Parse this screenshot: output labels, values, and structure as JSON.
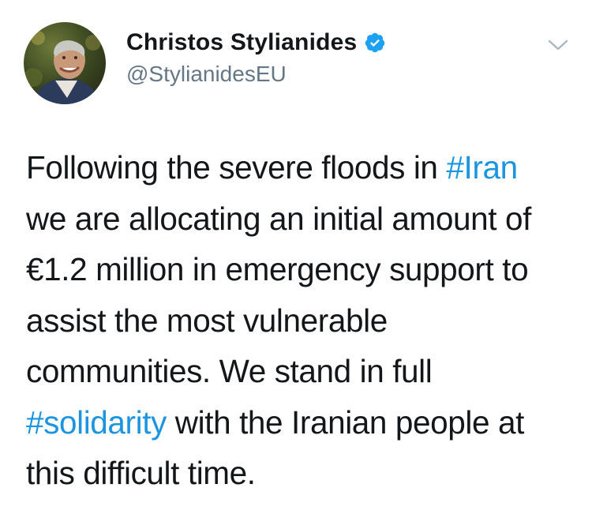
{
  "user": {
    "display_name": "Christos Stylianides",
    "handle": "@StylianidesEU",
    "verified": true,
    "verified_color": "#1da1f2"
  },
  "menu": {
    "icon": "chevron-down-icon"
  },
  "tweet": {
    "lines": [
      {
        "t1": "Following the severe floods in ",
        "hashtag": "#Iran",
        "t2": ""
      },
      {
        "t1": "we are allocating an initial amount of"
      },
      {
        "t1": "€1.2 million in emergency support to"
      },
      {
        "t1": "assist the most vulnerable"
      },
      {
        "t1": "communities. We stand in full"
      },
      {
        "t1": "",
        "hashtag": "#solidarity",
        "t2": " with the Iranian people at"
      },
      {
        "t1": "this difficult time."
      }
    ],
    "hashtag_color": "#1b95e0",
    "text_color": "#14171a"
  }
}
